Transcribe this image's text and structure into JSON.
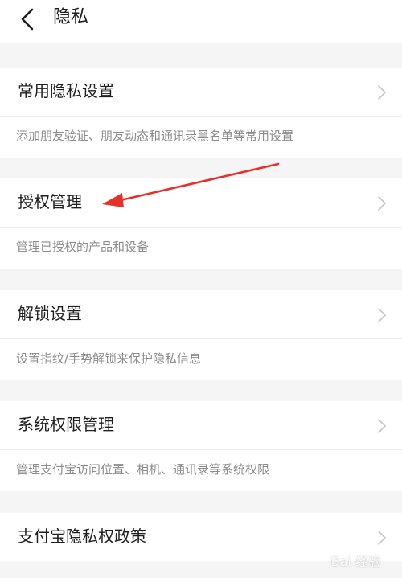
{
  "header": {
    "title": "隐私",
    "back_icon": "chevron-left-icon"
  },
  "settings": [
    {
      "label": "常用隐私设置",
      "description": "添加朋友验证、朋友动态和通讯录黑名单等常用设置"
    },
    {
      "label": "授权管理",
      "description": "管理已授权的产品和设备"
    },
    {
      "label": "解锁设置",
      "description": "设置指纹/手势解锁来保护隐私信息"
    },
    {
      "label": "系统权限管理",
      "description": "管理支付宝访问位置、相机、通讯录等系统权限"
    },
    {
      "label": "支付宝隐私权政策",
      "description": ""
    }
  ],
  "annotation": {
    "arrow_color": "#e8302a",
    "target": "授权管理"
  },
  "watermark": {
    "text": "Bai 经验"
  },
  "colors": {
    "background": "#f5f5f5",
    "surface": "#ffffff",
    "text_primary": "#1f1f1f",
    "text_secondary": "#8c8c8c",
    "chevron": "#c8c8c8"
  }
}
